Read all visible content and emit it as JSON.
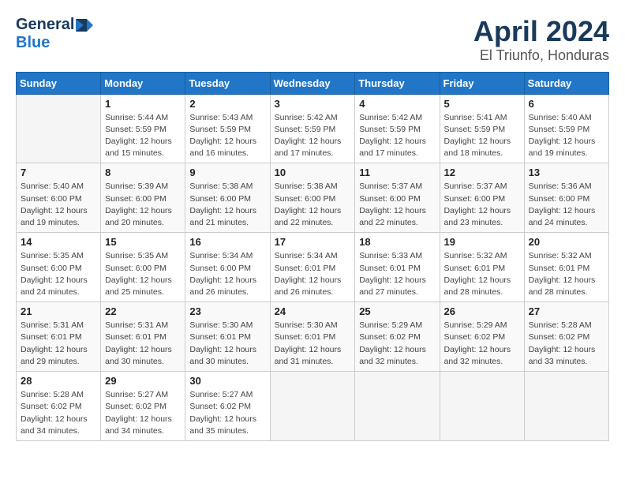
{
  "header": {
    "logo_general": "General",
    "logo_blue": "Blue",
    "title": "April 2024",
    "subtitle": "El Triunfo, Honduras"
  },
  "calendar": {
    "days_of_week": [
      "Sunday",
      "Monday",
      "Tuesday",
      "Wednesday",
      "Thursday",
      "Friday",
      "Saturday"
    ],
    "weeks": [
      [
        {
          "day": "",
          "info": ""
        },
        {
          "day": "1",
          "info": "Sunrise: 5:44 AM\nSunset: 5:59 PM\nDaylight: 12 hours\nand 15 minutes."
        },
        {
          "day": "2",
          "info": "Sunrise: 5:43 AM\nSunset: 5:59 PM\nDaylight: 12 hours\nand 16 minutes."
        },
        {
          "day": "3",
          "info": "Sunrise: 5:42 AM\nSunset: 5:59 PM\nDaylight: 12 hours\nand 17 minutes."
        },
        {
          "day": "4",
          "info": "Sunrise: 5:42 AM\nSunset: 5:59 PM\nDaylight: 12 hours\nand 17 minutes."
        },
        {
          "day": "5",
          "info": "Sunrise: 5:41 AM\nSunset: 5:59 PM\nDaylight: 12 hours\nand 18 minutes."
        },
        {
          "day": "6",
          "info": "Sunrise: 5:40 AM\nSunset: 5:59 PM\nDaylight: 12 hours\nand 19 minutes."
        }
      ],
      [
        {
          "day": "7",
          "info": "Sunrise: 5:40 AM\nSunset: 6:00 PM\nDaylight: 12 hours\nand 19 minutes."
        },
        {
          "day": "8",
          "info": "Sunrise: 5:39 AM\nSunset: 6:00 PM\nDaylight: 12 hours\nand 20 minutes."
        },
        {
          "day": "9",
          "info": "Sunrise: 5:38 AM\nSunset: 6:00 PM\nDaylight: 12 hours\nand 21 minutes."
        },
        {
          "day": "10",
          "info": "Sunrise: 5:38 AM\nSunset: 6:00 PM\nDaylight: 12 hours\nand 22 minutes."
        },
        {
          "day": "11",
          "info": "Sunrise: 5:37 AM\nSunset: 6:00 PM\nDaylight: 12 hours\nand 22 minutes."
        },
        {
          "day": "12",
          "info": "Sunrise: 5:37 AM\nSunset: 6:00 PM\nDaylight: 12 hours\nand 23 minutes."
        },
        {
          "day": "13",
          "info": "Sunrise: 5:36 AM\nSunset: 6:00 PM\nDaylight: 12 hours\nand 24 minutes."
        }
      ],
      [
        {
          "day": "14",
          "info": "Sunrise: 5:35 AM\nSunset: 6:00 PM\nDaylight: 12 hours\nand 24 minutes."
        },
        {
          "day": "15",
          "info": "Sunrise: 5:35 AM\nSunset: 6:00 PM\nDaylight: 12 hours\nand 25 minutes."
        },
        {
          "day": "16",
          "info": "Sunrise: 5:34 AM\nSunset: 6:00 PM\nDaylight: 12 hours\nand 26 minutes."
        },
        {
          "day": "17",
          "info": "Sunrise: 5:34 AM\nSunset: 6:01 PM\nDaylight: 12 hours\nand 26 minutes."
        },
        {
          "day": "18",
          "info": "Sunrise: 5:33 AM\nSunset: 6:01 PM\nDaylight: 12 hours\nand 27 minutes."
        },
        {
          "day": "19",
          "info": "Sunrise: 5:32 AM\nSunset: 6:01 PM\nDaylight: 12 hours\nand 28 minutes."
        },
        {
          "day": "20",
          "info": "Sunrise: 5:32 AM\nSunset: 6:01 PM\nDaylight: 12 hours\nand 28 minutes."
        }
      ],
      [
        {
          "day": "21",
          "info": "Sunrise: 5:31 AM\nSunset: 6:01 PM\nDaylight: 12 hours\nand 29 minutes."
        },
        {
          "day": "22",
          "info": "Sunrise: 5:31 AM\nSunset: 6:01 PM\nDaylight: 12 hours\nand 30 minutes."
        },
        {
          "day": "23",
          "info": "Sunrise: 5:30 AM\nSunset: 6:01 PM\nDaylight: 12 hours\nand 30 minutes."
        },
        {
          "day": "24",
          "info": "Sunrise: 5:30 AM\nSunset: 6:01 PM\nDaylight: 12 hours\nand 31 minutes."
        },
        {
          "day": "25",
          "info": "Sunrise: 5:29 AM\nSunset: 6:02 PM\nDaylight: 12 hours\nand 32 minutes."
        },
        {
          "day": "26",
          "info": "Sunrise: 5:29 AM\nSunset: 6:02 PM\nDaylight: 12 hours\nand 32 minutes."
        },
        {
          "day": "27",
          "info": "Sunrise: 5:28 AM\nSunset: 6:02 PM\nDaylight: 12 hours\nand 33 minutes."
        }
      ],
      [
        {
          "day": "28",
          "info": "Sunrise: 5:28 AM\nSunset: 6:02 PM\nDaylight: 12 hours\nand 34 minutes."
        },
        {
          "day": "29",
          "info": "Sunrise: 5:27 AM\nSunset: 6:02 PM\nDaylight: 12 hours\nand 34 minutes."
        },
        {
          "day": "30",
          "info": "Sunrise: 5:27 AM\nSunset: 6:02 PM\nDaylight: 12 hours\nand 35 minutes."
        },
        {
          "day": "",
          "info": ""
        },
        {
          "day": "",
          "info": ""
        },
        {
          "day": "",
          "info": ""
        },
        {
          "day": "",
          "info": ""
        }
      ]
    ]
  }
}
